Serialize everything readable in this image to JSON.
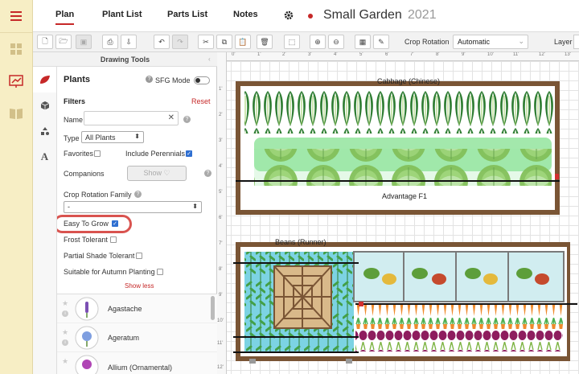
{
  "nav": {
    "tabs": [
      {
        "label": "Plan"
      },
      {
        "label": "Plant List"
      },
      {
        "label": "Parts List"
      },
      {
        "label": "Notes"
      }
    ],
    "plan_name": "Small Garden",
    "plan_year": "2021"
  },
  "toolbar": {
    "crop_rotation_label": "Crop Rotation",
    "crop_rotation_value": "Automatic",
    "layer_label": "Layer"
  },
  "panel": {
    "header": "Drawing Tools",
    "title": "Plants",
    "sfg_mode": "SFG Mode",
    "filters": "Filters",
    "reset": "Reset",
    "name_label": "Name",
    "name_value": "",
    "type_label": "Type",
    "type_value": "All Plants",
    "favorites": "Favorites",
    "include_perennials": "Include Perennials",
    "companions": "Companions",
    "show_btn": "Show",
    "crop_rotation_family": "Crop Rotation Family",
    "crop_rotation_family_value": "-",
    "easy_to_grow": "Easy To Grow",
    "frost_tolerant": "Frost Tolerant",
    "partial_shade": "Partial Shade Tolerant",
    "autumn": "Suitable for Autumn Planting",
    "show_less": "Show less",
    "plants": [
      {
        "name": "Agastache"
      },
      {
        "name": "Ageratum"
      },
      {
        "name": "Allium (Ornamental)"
      }
    ]
  },
  "canvas": {
    "ruler_top": [
      "0'",
      "1'",
      "2'",
      "3'",
      "4'",
      "5'",
      "6'",
      "7'",
      "8'",
      "9'",
      "10'",
      "11'",
      "12'",
      "13'"
    ],
    "ruler_left": [
      "1'",
      "2'",
      "3'",
      "4'",
      "5'",
      "6'",
      "7'",
      "8'",
      "9'",
      "10'",
      "11'",
      "12'"
    ],
    "labels": {
      "cabbage": "Cabbage (Chinese)",
      "advantage": "Advantage F1",
      "beans": "Beans (Runner)"
    }
  },
  "colors": {
    "accent": "#c62828",
    "rail_bg": "#f7eec5",
    "bed_wood": "#6b4a2e",
    "highlight_ring": "#d9534f"
  }
}
